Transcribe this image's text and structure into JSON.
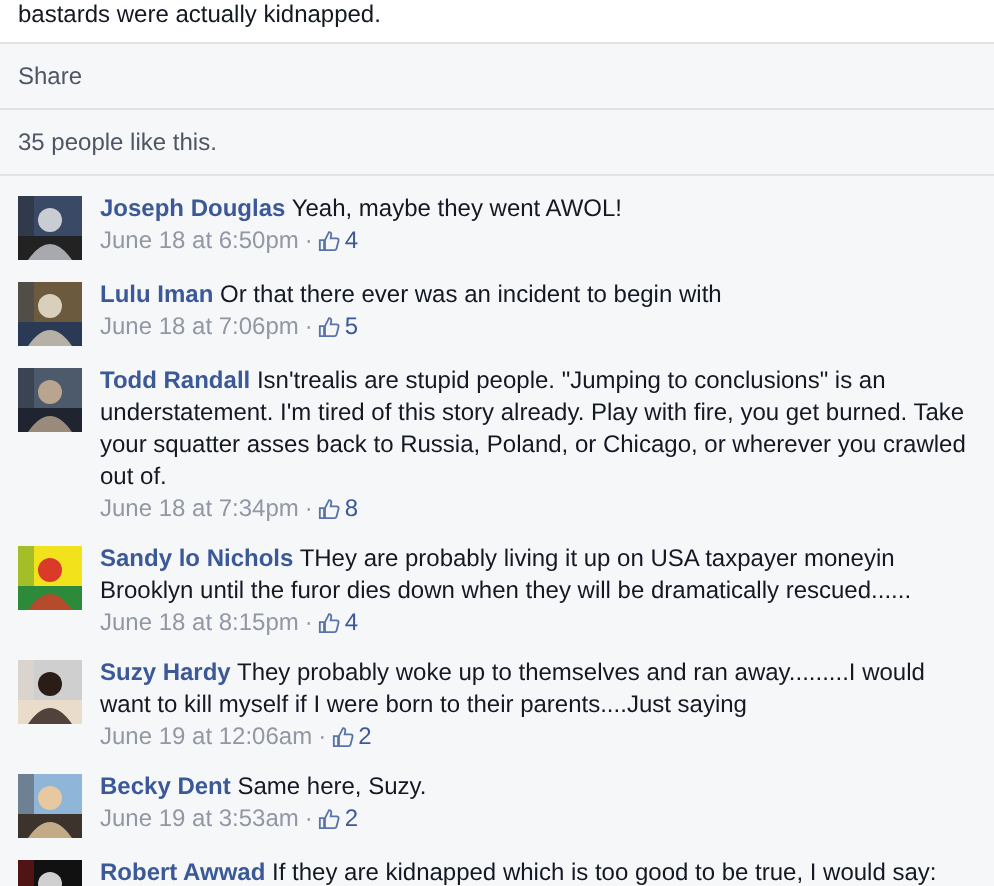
{
  "post": {
    "text": "bastards were actually kidnapped."
  },
  "actions": [
    {
      "label": "Share"
    }
  ],
  "likes_summary": "35 people like this.",
  "comments": [
    {
      "author": "Joseph Douglas",
      "text": "Yeah, maybe they went AWOL!",
      "time": "June 18 at 6:50pm",
      "separator": "·",
      "likes": "4"
    },
    {
      "author": "Lulu Iman",
      "text": "Or that there ever was an incident to begin with",
      "time": "June 18 at 7:06pm",
      "separator": "·",
      "likes": "5"
    },
    {
      "author": "Todd Randall",
      "text": "Isn'trealis are stupid people. \"Jumping to conclusions\" is an understatement. I'm tired of this story already. Play with fire, you get burned. Take your squatter asses back to Russia, Poland, or Chicago, or wherever you crawled out of.",
      "time": "June 18 at 7:34pm",
      "separator": "·",
      "likes": "8"
    },
    {
      "author": "Sandy lo Nichols",
      "text": "THey are probably living it up on USA taxpayer moneyin Brooklyn until the furor dies down when they will be dramatically rescued......",
      "time": "June 18 at 8:15pm",
      "separator": "·",
      "likes": "4"
    },
    {
      "author": "Suzy Hardy",
      "text": "They probably woke up to themselves and ran away.........I would want to kill myself if I were born to their parents....Just saying",
      "time": "June 19 at 12:06am",
      "separator": "·",
      "likes": "2"
    },
    {
      "author": "Becky Dent",
      "text": "Same here, Suzy.",
      "time": "June 19 at 3:53am",
      "separator": "·",
      "likes": "2"
    },
    {
      "author": "Robert Awwad",
      "text": "If they are kidnapped which is too good to be true, I would say:"
    }
  ]
}
